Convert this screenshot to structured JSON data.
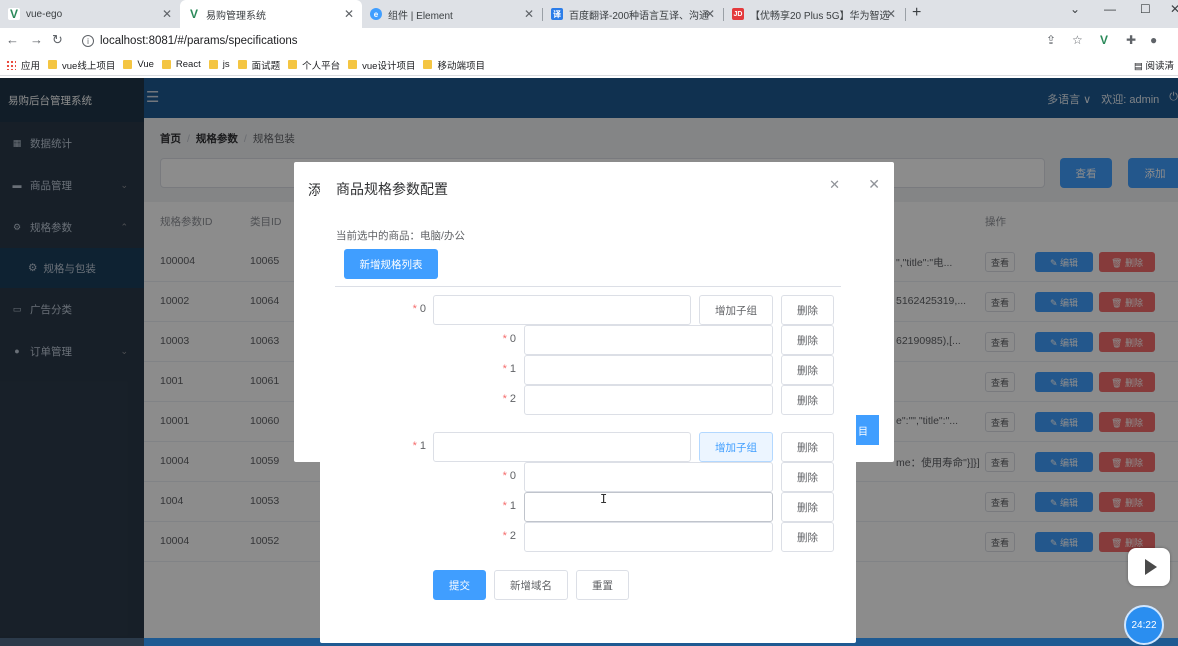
{
  "browser": {
    "tabs": [
      {
        "title": "vue-ego",
        "favicon_color": "#2b8a5a",
        "favicon_glyph": "V"
      },
      {
        "title": "易购管理系统",
        "favicon_color": "#2b8a5a",
        "favicon_glyph": "V"
      },
      {
        "title": "组件 | Element",
        "favicon_color": "#409eff",
        "favicon_glyph": "e"
      },
      {
        "title": "百度翻译-200种语言互译、沟通",
        "favicon_color": "#2b7de9",
        "favicon_glyph": "译"
      },
      {
        "title": "【优畅享20 Plus 5G】华为智选",
        "favicon_color": "#e4393c",
        "favicon_glyph": "JD"
      }
    ],
    "url": "localhost:8081/#/params/specifications",
    "bookmarks": [
      "应用",
      "vue线上项目",
      "Vue",
      "React",
      "js",
      "面试题",
      "个人平台",
      "vue设计项目",
      "移动端项目"
    ],
    "reading_mode": "阅读清"
  },
  "app": {
    "logo": "易购后台管理系统",
    "menu": [
      {
        "label": "数据统计",
        "icon": "grid-icon",
        "arrow": ""
      },
      {
        "label": "商品管理",
        "icon": "bag-icon",
        "arrow": "⌄"
      },
      {
        "label": "规格参数",
        "icon": "gear-icon",
        "arrow": "⌃"
      },
      {
        "label": "规格与包装",
        "icon": "gear-icon",
        "arrow": ""
      },
      {
        "label": "广告分类",
        "icon": "monitor-icon",
        "arrow": ""
      },
      {
        "label": "订单管理",
        "icon": "location-icon",
        "arrow": "⌄"
      }
    ],
    "language": "多语言 ∨",
    "welcome": "欢迎: admin",
    "breadcrumb": [
      "首页",
      "规格参数",
      "规格包装"
    ],
    "search_button": "查看",
    "add_button": "添加",
    "table": {
      "headers": [
        "规格参数ID",
        "类目ID",
        "操作"
      ],
      "rows": [
        {
          "id": "100004",
          "cat": "10065",
          "spec": "\",\"title\":\"电..."
        },
        {
          "id": "10002",
          "cat": "10064",
          "spec": "5162425319,..."
        },
        {
          "id": "10003",
          "cat": "10063",
          "spec": "62190985),[..."
        },
        {
          "id": "1001",
          "cat": "10061",
          "spec": ""
        },
        {
          "id": "10001",
          "cat": "10060",
          "spec": "e\":\"\",\"title\":\"..."
        },
        {
          "id": "10004",
          "cat": "10059",
          "spec": "me：使用寿命\"}]}]"
        },
        {
          "id": "1004",
          "cat": "10053",
          "spec": ""
        },
        {
          "id": "10004",
          "cat": "10052",
          "spec": ""
        }
      ],
      "view_label": "查看",
      "edit_label": "✎ 编辑",
      "delete_label": "🗑 删除"
    },
    "ghost_dialog": {
      "title": "添",
      "button_text": "目"
    }
  },
  "dialog": {
    "title": "商品规格参数配置",
    "current_product": "当前选中的商品：电脑/办公",
    "add_list_button": "新增规格列表",
    "groups": [
      {
        "label": "0",
        "add_sub_label": "增加子组",
        "delete_label": "删除",
        "children": [
          {
            "label": "0",
            "delete_label": "删除"
          },
          {
            "label": "1",
            "delete_label": "删除"
          },
          {
            "label": "2",
            "delete_label": "删除"
          }
        ]
      },
      {
        "label": "1",
        "add_sub_label": "增加子组",
        "delete_label": "删除",
        "children": [
          {
            "label": "0",
            "delete_label": "删除"
          },
          {
            "label": "1",
            "delete_label": "删除"
          },
          {
            "label": "2",
            "delete_label": "删除"
          }
        ]
      }
    ],
    "submit_button": "提交",
    "add_domain_button": "新增域名",
    "reset_button": "重置"
  },
  "overlay": {
    "timer": "24:22"
  },
  "colors": {
    "primary": "#409eff",
    "danger": "#f56c6c",
    "sidebar": "#2b3a4a",
    "header": "#1e5a92"
  }
}
